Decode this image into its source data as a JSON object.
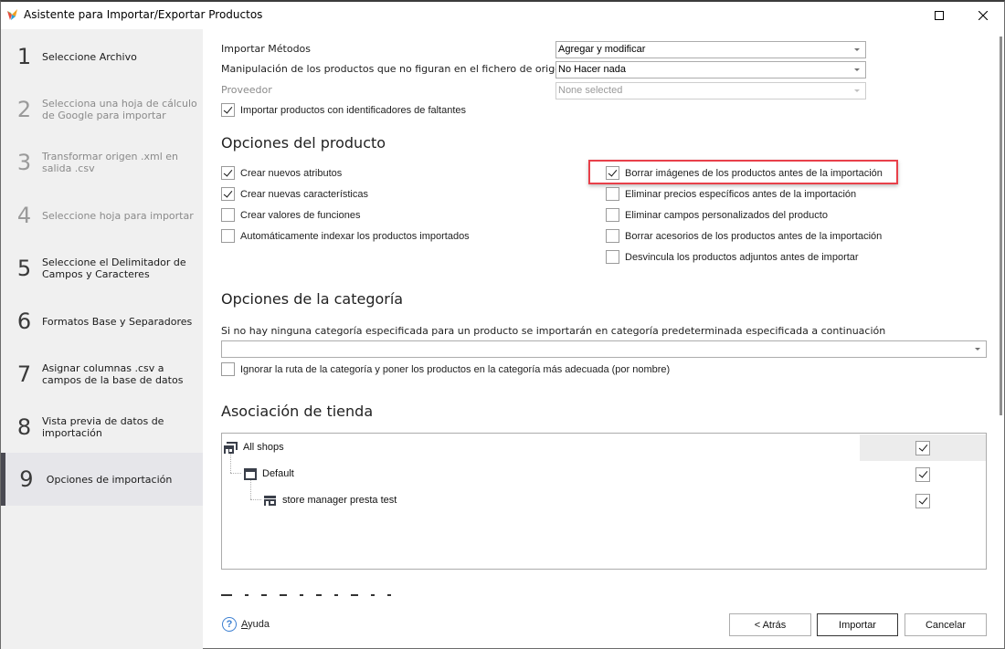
{
  "window": {
    "title": "Asistente para Importar/Exportar Productos",
    "maximize_icon": "maximize-icon",
    "close_icon": "close-icon"
  },
  "sidebar": {
    "steps": [
      {
        "num": "1",
        "label": "Seleccione Archivo",
        "state": "normal"
      },
      {
        "num": "2",
        "label": "Selecciona una hoja de cálculo de Google para importar",
        "state": "disabled"
      },
      {
        "num": "3",
        "label": "Transformar origen .xml en salida .csv",
        "state": "disabled"
      },
      {
        "num": "4",
        "label": "Seleccione hoja para importar",
        "state": "disabled"
      },
      {
        "num": "5",
        "label": "Seleccione el Delimitador de Campos y Caracteres",
        "state": "normal"
      },
      {
        "num": "6",
        "label": "Formatos Base y Separadores",
        "state": "normal"
      },
      {
        "num": "7",
        "label": "Asignar columnas .csv a campos de la base de datos",
        "state": "normal"
      },
      {
        "num": "8",
        "label": "Vista previa de datos de importación",
        "state": "normal"
      },
      {
        "num": "9",
        "label": "Opciones de importación",
        "state": "active"
      }
    ]
  },
  "import": {
    "method_label": "Importar Métodos",
    "method_value": "Agregar y modificar",
    "missing_label": "Manipulación de los productos que no figuran en el fichero de origen",
    "missing_value": "No Hacer nada",
    "supplier_label": "Proveedor",
    "supplier_value": "None selected",
    "missing_ids_label": "Importar productos con identificadores de faltantes",
    "missing_ids_checked": true
  },
  "product_options": {
    "title": "Opciones del producto",
    "left": [
      {
        "label": "Crear nuevos atributos",
        "checked": true
      },
      {
        "label": "Crear nuevas características",
        "checked": true
      },
      {
        "label": "Crear valores de funciones",
        "checked": false
      },
      {
        "label": "Automáticamente indexar los productos importados",
        "checked": false
      }
    ],
    "right": [
      {
        "label": "Borrar imágenes de los productos antes de la importación",
        "checked": true
      },
      {
        "label": "Eliminar precios específicos antes de la importación",
        "checked": false
      },
      {
        "label": "Eliminar campos personalizados del producto",
        "checked": false
      },
      {
        "label": "Borrar acesorios de los productos antes de la importación",
        "checked": false
      },
      {
        "label": "Desvincula los productos adjuntos antes de importar",
        "checked": false
      }
    ],
    "highlight_color": "#e8404a"
  },
  "category_options": {
    "title": "Opciones de la categoría",
    "description": "Si no hay ninguna categoría especificada para un producto se importarán en categoría predeterminada especificada a continuación",
    "default_category_value": "",
    "ignore_path_label": "Ignorar la ruta de la categoría y poner los productos en la categoría más adecuada (por nombre)",
    "ignore_path_checked": false
  },
  "shop_association": {
    "title": "Asociación de tienda",
    "nodes": [
      {
        "label": "All shops",
        "icon": "shop-group-icon",
        "checked": true,
        "level": 0
      },
      {
        "label": "Default",
        "icon": "shop-window-icon",
        "checked": true,
        "level": 1
      },
      {
        "label": "store manager presta test",
        "icon": "store-icon",
        "checked": true,
        "level": 2
      }
    ]
  },
  "footer": {
    "help_label": "Ayuda",
    "back_label": "< Atrás",
    "import_label": "Importar",
    "cancel_label": "Cancelar"
  }
}
